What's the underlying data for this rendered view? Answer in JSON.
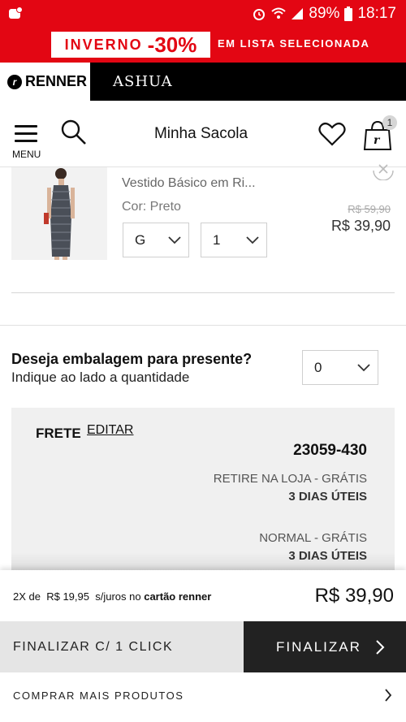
{
  "status_bar": {
    "battery": "89%",
    "time": "18:17",
    "icons": [
      "app-notification-icon",
      "alarm-icon",
      "wifi-icon",
      "signal-icon",
      "battery-icon"
    ]
  },
  "promo": {
    "word": "INVERNO",
    "discount": "-30%",
    "text": "EM LISTA SELECIONADA"
  },
  "brands": {
    "renner": "RENNER",
    "renner_logo": "r",
    "ashua": "ASHUA"
  },
  "header": {
    "menu_label": "MENU",
    "title": "Minha Sacola",
    "bag_count": "1"
  },
  "product": {
    "name": "Vestido Básico em Ri...",
    "color": "Cor: Preto",
    "old_price": "R$ 59,90",
    "price": "R$ 39,90",
    "size": "G",
    "quantity": "1"
  },
  "gift": {
    "question": "Deseja embalagem para presente?",
    "subtitle": "Indique ao lado a quantidade",
    "quantity": "0"
  },
  "shipping": {
    "title": "FRETE",
    "edit": "EDITAR",
    "cep": "23059-430",
    "options": [
      {
        "label": "RETIRE NA LOJA -  GRÁTIS",
        "days": "3 DIAS ÚTEIS"
      },
      {
        "label": "NORMAL -  GRÁTIS",
        "days": "3 DIAS ÚTEIS"
      }
    ]
  },
  "summary": {
    "installments_prefix": "2X de",
    "installment_value": "R$ 19,95",
    "installments_middle": "s/juros no",
    "card": "cartão renner",
    "total": "R$ 39,90"
  },
  "actions": {
    "one_click": "FINALIZAR C/ 1 CLICK",
    "finalize": "FINALIZAR",
    "more_products": "COMPRAR MAIS PRODUTOS"
  },
  "colors": {
    "brand_red": "#e30613",
    "dark": "#222222",
    "panel": "#f0f0f0"
  }
}
